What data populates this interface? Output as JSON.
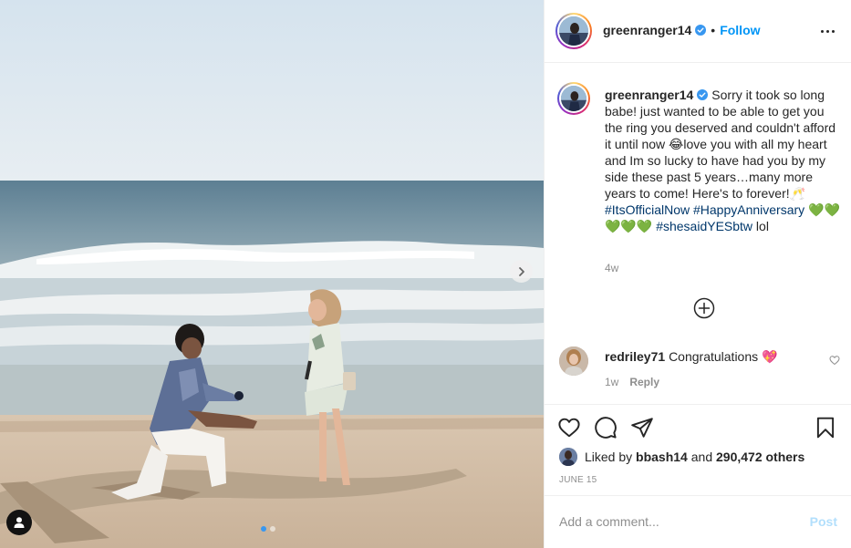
{
  "post": {
    "author": "greenranger14",
    "header": {
      "separator": "•",
      "follow_label": "Follow",
      "more_icon": "more-horizontal-icon"
    },
    "caption": {
      "username": "greenranger14",
      "body_1": "Sorry it took so long babe! just wanted to be able to get you the ring you deserved and couldn't afford it until now",
      "emoji_laugh": "😂",
      "body_2": "love you with all my heart and Im so lucky to have had you by my side these past 5 years…many more years to come! Here's to forever!",
      "emoji_cheers": "🥂",
      "hashtag_1": "#ItsOfficialNow",
      "hashtag_2": "#HappyAnniversary",
      "emoji_hearts": "💚💚💚💚💚",
      "hashtag_3": "#shesaidYESbtw",
      "tail": " lol",
      "time_ago": "4w"
    },
    "comments": [
      {
        "username": "redriley71",
        "text": "Congratulations",
        "emoji": "💖",
        "time_ago": "1w",
        "reply_label": "Reply"
      }
    ],
    "likes": {
      "prefix": "Liked by",
      "first_liker": "bbash14",
      "and": "and",
      "others": "290,472 others"
    },
    "date": "JUNE 15",
    "add_comment": {
      "placeholder": "Add a comment...",
      "post_label": "Post"
    },
    "carousel": {
      "total_slides": 2,
      "active_index": 0
    },
    "colors": {
      "link_blue": "#0095f6",
      "hashtag": "#00376b",
      "muted": "#8e8e8e",
      "post_disabled": "#b2dffc",
      "carousel_active_dot": "#3897f0"
    }
  }
}
